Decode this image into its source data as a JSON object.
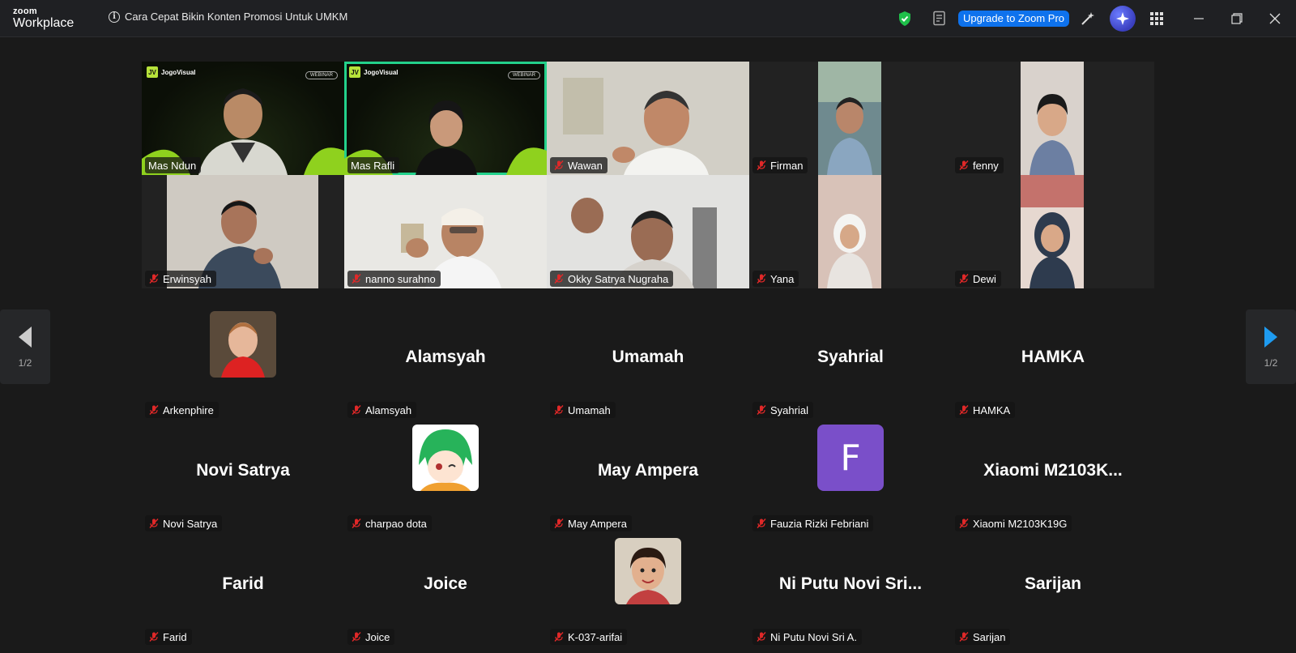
{
  "app": {
    "brand_small": "zoom",
    "brand_large": "Workplace"
  },
  "meeting": {
    "title": "Cara Cepat Bikin Konten Promosi Untuk UMKM"
  },
  "toolbar": {
    "upgrade_label": "Upgrade to Zoom Pro"
  },
  "video_tiles": [
    {
      "name": "Mas Ndun",
      "muted": false,
      "active": false
    },
    {
      "name": "Mas Rafli",
      "muted": false,
      "active": true
    },
    {
      "name": "Wawan",
      "muted": true,
      "active": false
    },
    {
      "name": "Firman",
      "muted": true,
      "active": false
    },
    {
      "name": "fenny",
      "muted": true,
      "active": false
    },
    {
      "name": "Erwinsyah",
      "muted": true,
      "active": false
    },
    {
      "name": "nanno surahno",
      "muted": true,
      "active": false
    },
    {
      "name": "Okky Satrya Nugraha",
      "muted": true,
      "active": false
    },
    {
      "name": "Yana",
      "muted": true,
      "active": false
    },
    {
      "name": "Dewi",
      "muted": true,
      "active": false
    }
  ],
  "webinar": {
    "brand": "JogoVisual",
    "badge": "JV",
    "tag": "WEBINAR"
  },
  "avatar_tiles": [
    {
      "big": "",
      "name": "Arkenphire",
      "avatar": "photo-child"
    },
    {
      "big": "Alamsyah",
      "name": "Alamsyah"
    },
    {
      "big": "Umamah",
      "name": "Umamah"
    },
    {
      "big": "Syahrial",
      "name": "Syahrial"
    },
    {
      "big": "HAMKA",
      "name": "HAMKA"
    },
    {
      "big": "Novi Satrya",
      "name": "Novi Satrya"
    },
    {
      "big": "",
      "name": "charpao dota",
      "avatar": "anime-green"
    },
    {
      "big": "May Ampera",
      "name": "May Ampera"
    },
    {
      "big": "",
      "name": "Fauzia Rizki Febriani",
      "letter": "F"
    },
    {
      "big": "Xiaomi  M2103K...",
      "name": "Xiaomi M2103K19G"
    },
    {
      "big": "Farid",
      "name": "Farid"
    },
    {
      "big": "Joice",
      "name": "Joice"
    },
    {
      "big": "",
      "name": "K-037-arifai",
      "avatar": "photo-girl"
    },
    {
      "big": "Ni Putu Novi Sri...",
      "name": "Ni Putu Novi Sri A."
    },
    {
      "big": "Sarijan",
      "name": "Sarijan"
    }
  ],
  "pager": {
    "left_label": "1/2",
    "right_label": "1/2"
  },
  "colors": {
    "active_speaker": "#23d18b",
    "upgrade": "#0e72ed",
    "muted_red": "#e02828",
    "avatar_purple": "#7a4fc9"
  }
}
